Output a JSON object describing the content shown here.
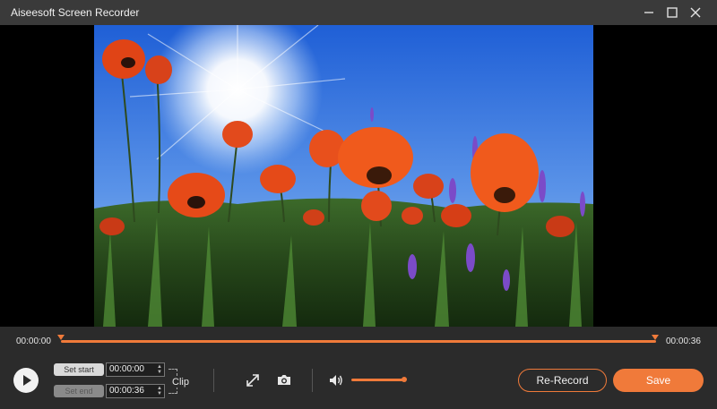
{
  "window": {
    "title": "Aiseesoft Screen Recorder",
    "minimize_icon": "minimize-icon",
    "maximize_icon": "maximize-icon",
    "close_icon": "close-icon"
  },
  "player": {
    "current_time": "00:00:00",
    "total_time": "00:00:36"
  },
  "clip": {
    "set_start_label": "Set start",
    "set_end_label": "Set end",
    "start_value": "00:00:00",
    "end_value": "00:00:36",
    "clip_label": "Clip"
  },
  "actions": {
    "rerecord_label": "Re-Record",
    "save_label": "Save"
  },
  "colors": {
    "accent": "#f07a3a",
    "background": "#2b2b2b",
    "titlebar": "#3a3a3a"
  }
}
